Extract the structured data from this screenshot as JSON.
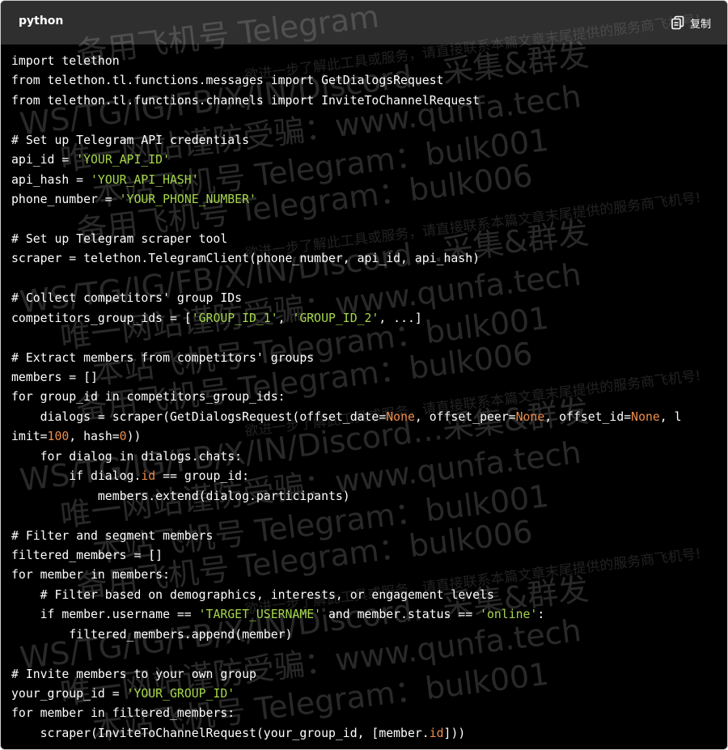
{
  "header": {
    "language": "python",
    "copy_label": "复制",
    "copy_icon": "copy-icon"
  },
  "code": {
    "lines": [
      [
        {
          "t": "import telethon",
          "c": "plain"
        }
      ],
      [
        {
          "t": "from telethon.tl.functions.messages import GetDialogsRequest",
          "c": "plain"
        }
      ],
      [
        {
          "t": "from telethon.tl.functions.channels import InviteToChannelRequest",
          "c": "plain"
        }
      ],
      [],
      [
        {
          "t": "# Set up Telegram API credentials",
          "c": "comment"
        }
      ],
      [
        {
          "t": "api_id = ",
          "c": "plain"
        },
        {
          "t": "'YOUR_API_ID'",
          "c": "string"
        }
      ],
      [
        {
          "t": "api_hash = ",
          "c": "plain"
        },
        {
          "t": "'YOUR_API_HASH'",
          "c": "string"
        }
      ],
      [
        {
          "t": "phone_number = ",
          "c": "plain"
        },
        {
          "t": "'YOUR_PHONE_NUMBER'",
          "c": "string"
        }
      ],
      [],
      [
        {
          "t": "# Set up Telegram scraper tool",
          "c": "comment"
        }
      ],
      [
        {
          "t": "scraper = telethon.TelegramClient(phone_number, api_id, api_hash)",
          "c": "plain"
        }
      ],
      [],
      [
        {
          "t": "# Collect competitors' group IDs",
          "c": "comment"
        }
      ],
      [
        {
          "t": "competitors_group_ids = [",
          "c": "plain"
        },
        {
          "t": "'GROUP_ID_1'",
          "c": "string"
        },
        {
          "t": ", ",
          "c": "plain"
        },
        {
          "t": "'GROUP_ID_2'",
          "c": "string"
        },
        {
          "t": ", ...]",
          "c": "plain"
        }
      ],
      [],
      [
        {
          "t": "# Extract members from competitors' groups",
          "c": "comment"
        }
      ],
      [
        {
          "t": "members = []",
          "c": "plain"
        }
      ],
      [
        {
          "t": "for group_id in competitors_group_ids:",
          "c": "plain"
        }
      ],
      [
        {
          "t": "    dialogs = scraper(GetDialogsRequest(offset_date=",
          "c": "plain"
        },
        {
          "t": "None",
          "c": "number"
        },
        {
          "t": ", offset_peer=",
          "c": "plain"
        },
        {
          "t": "None",
          "c": "number"
        },
        {
          "t": ", offset_id=",
          "c": "plain"
        },
        {
          "t": "None",
          "c": "number"
        },
        {
          "t": ", l",
          "c": "plain"
        }
      ],
      [
        {
          "t": "imit=",
          "c": "plain"
        },
        {
          "t": "100",
          "c": "number"
        },
        {
          "t": ", hash=",
          "c": "plain"
        },
        {
          "t": "0",
          "c": "number"
        },
        {
          "t": "))",
          "c": "plain"
        }
      ],
      [
        {
          "t": "    for dialog in dialogs.chats:",
          "c": "plain"
        }
      ],
      [
        {
          "t": "        if dialog.",
          "c": "plain"
        },
        {
          "t": "id",
          "c": "number"
        },
        {
          "t": " == group_id:",
          "c": "plain"
        }
      ],
      [
        {
          "t": "            members.extend(dialog.participants)",
          "c": "plain"
        }
      ],
      [],
      [
        {
          "t": "# Filter and segment members",
          "c": "comment"
        }
      ],
      [
        {
          "t": "filtered_members = []",
          "c": "plain"
        }
      ],
      [
        {
          "t": "for member in members:",
          "c": "plain"
        }
      ],
      [
        {
          "t": "    # Filter based on demographics, interests, or engagement levels",
          "c": "comment"
        }
      ],
      [
        {
          "t": "    if member.username == ",
          "c": "plain"
        },
        {
          "t": "'TARGET_USERNAME'",
          "c": "string"
        },
        {
          "t": " and member.status == ",
          "c": "plain"
        },
        {
          "t": "'online'",
          "c": "string"
        },
        {
          "t": ":",
          "c": "plain"
        }
      ],
      [
        {
          "t": "        filtered_members.append(member)",
          "c": "plain"
        }
      ],
      [],
      [
        {
          "t": "# Invite members to your own group",
          "c": "comment"
        }
      ],
      [
        {
          "t": "your_group_id = ",
          "c": "plain"
        },
        {
          "t": "'YOUR_GROUP_ID'",
          "c": "string"
        }
      ],
      [
        {
          "t": "for member in filtered_members:",
          "c": "plain"
        }
      ],
      [
        {
          "t": "    scraper(InviteToChannelRequest(your_group_id, [member.",
          "c": "plain"
        },
        {
          "t": "id",
          "c": "number"
        },
        {
          "t": "]))",
          "c": "plain"
        }
      ]
    ]
  },
  "watermarks": [
    {
      "text": "备用飞机号 Telegram",
      "size": "big"
    },
    {
      "text": "欲进一步了解此工具或服务，请直接联系本篇文章末尾提供的服务商飞机号!",
      "size": "small"
    },
    {
      "text": "WS/TG/IG/FB/X/IN/Discord…采集&群发",
      "size": "big"
    },
    {
      "text": "唯一网站谨防受骗：www.qunfa.tech",
      "size": "big"
    },
    {
      "text": "本站飞机号 Telegram：bulk001",
      "size": "big"
    },
    {
      "text": "备用飞机号 Telegram：bulk006",
      "size": "big"
    },
    {
      "text": "欲进一步了解此工具或服务，请直接联系本篇文章末尾提供的服务商飞机号!",
      "size": "small"
    },
    {
      "text": "WS/TG/IG/FB/X/IN/Discord…采集&群发",
      "size": "big"
    },
    {
      "text": "唯一网站谨防受骗：www.qunfa.tech",
      "size": "big"
    },
    {
      "text": "本站飞机号 Telegram：bulk001",
      "size": "big"
    },
    {
      "text": "备用飞机号 Telegram：bulk006",
      "size": "big"
    },
    {
      "text": "欲进一步了解此工具或服务，请直接联系本篇文章末尾提供的服务商飞机号!",
      "size": "small"
    },
    {
      "text": "WS/TG/IG/FB/X/IN/Discord…采集&群发",
      "size": "big"
    },
    {
      "text": "唯一网站谨防受骗：www.qunfa.tech",
      "size": "big"
    },
    {
      "text": "本站飞机号 Telegram：bulk001",
      "size": "big"
    },
    {
      "text": "备用飞机号 Telegram：bulk006",
      "size": "big"
    },
    {
      "text": "欲进一步了解此工具或服务，请直接联系本篇文章末尾提供的服务商飞机号!",
      "size": "small"
    },
    {
      "text": "WS/TG/IG/FB/X/IN/Discord…采集&群发",
      "size": "big"
    },
    {
      "text": "唯一网站谨防受骗：www.qunfa.tech",
      "size": "big"
    },
    {
      "text": "本站飞机号 Telegram：bulk001",
      "size": "big"
    }
  ]
}
